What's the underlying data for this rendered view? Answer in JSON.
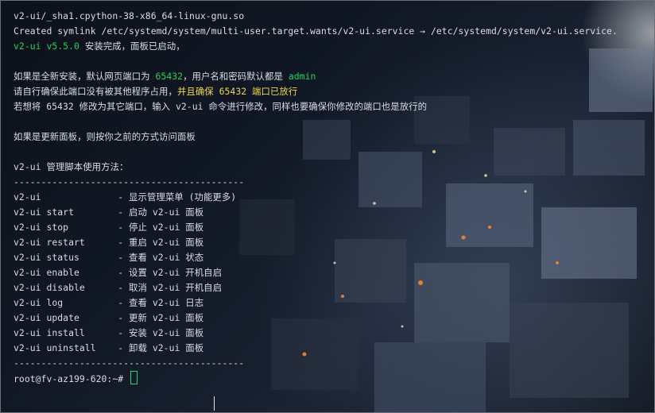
{
  "terminal": {
    "lines": [
      [
        {
          "text": "v2-ui/_sha1.cpython-38-x86_64-linux-gnu.so",
          "color": ""
        }
      ],
      [
        {
          "text": "Created symlink /etc/systemd/system/multi-user.target.wants/v2-ui.service → /etc/systemd/system/v2-ui.service.",
          "color": ""
        }
      ],
      [
        {
          "text": "v2-ui v5.5.0",
          "color": "green"
        },
        {
          "text": " 安装完成，面板已启动，",
          "color": ""
        }
      ],
      [
        {
          "text": "",
          "color": ""
        }
      ],
      [
        {
          "text": "如果是全新安装，默认网页端口为 ",
          "color": ""
        },
        {
          "text": "65432",
          "color": "green"
        },
        {
          "text": "，用户名和密码默认都是 ",
          "color": ""
        },
        {
          "text": "admin",
          "color": "green"
        }
      ],
      [
        {
          "text": "请自行确保此端口没有被其他程序占用，",
          "color": ""
        },
        {
          "text": "并且确保 65432 端口已放行",
          "color": "yellow"
        }
      ],
      [
        {
          "text": "若想将 65432 修改为其它端口，输入 v2-ui 命令进行修改，同样也要确保你修改的端口也是放行的",
          "color": ""
        }
      ],
      [
        {
          "text": "",
          "color": ""
        }
      ],
      [
        {
          "text": "如果是更新面板，则按你之前的方式访问面板",
          "color": ""
        }
      ],
      [
        {
          "text": "",
          "color": ""
        }
      ],
      [
        {
          "text": "v2-ui 管理脚本使用方法：",
          "color": ""
        }
      ],
      [
        {
          "text": "------------------------------------------",
          "color": ""
        }
      ],
      [
        {
          "text": "v2-ui              - 显示管理菜单 (功能更多)",
          "color": ""
        }
      ],
      [
        {
          "text": "v2-ui start        - 启动 v2-ui 面板",
          "color": ""
        }
      ],
      [
        {
          "text": "v2-ui stop         - 停止 v2-ui 面板",
          "color": ""
        }
      ],
      [
        {
          "text": "v2-ui restart      - 重启 v2-ui 面板",
          "color": ""
        }
      ],
      [
        {
          "text": "v2-ui status       - 查看 v2-ui 状态",
          "color": ""
        }
      ],
      [
        {
          "text": "v2-ui enable       - 设置 v2-ui 开机自启",
          "color": ""
        }
      ],
      [
        {
          "text": "v2-ui disable      - 取消 v2-ui 开机自启",
          "color": ""
        }
      ],
      [
        {
          "text": "v2-ui log          - 查看 v2-ui 日志",
          "color": ""
        }
      ],
      [
        {
          "text": "v2-ui update       - 更新 v2-ui 面板",
          "color": ""
        }
      ],
      [
        {
          "text": "v2-ui install      - 安装 v2-ui 面板",
          "color": ""
        }
      ],
      [
        {
          "text": "v2-ui uninstall    - 卸载 v2-ui 面板",
          "color": ""
        }
      ],
      [
        {
          "text": "------------------------------------------",
          "color": ""
        }
      ],
      [
        {
          "text": "root@fv-az199-620:~# ",
          "color": ""
        }
      ]
    ]
  },
  "colors": {
    "text": "#d8dde6",
    "green": "#23d160",
    "yellow": "#f0d84a",
    "cursor": "#2fd26a"
  }
}
